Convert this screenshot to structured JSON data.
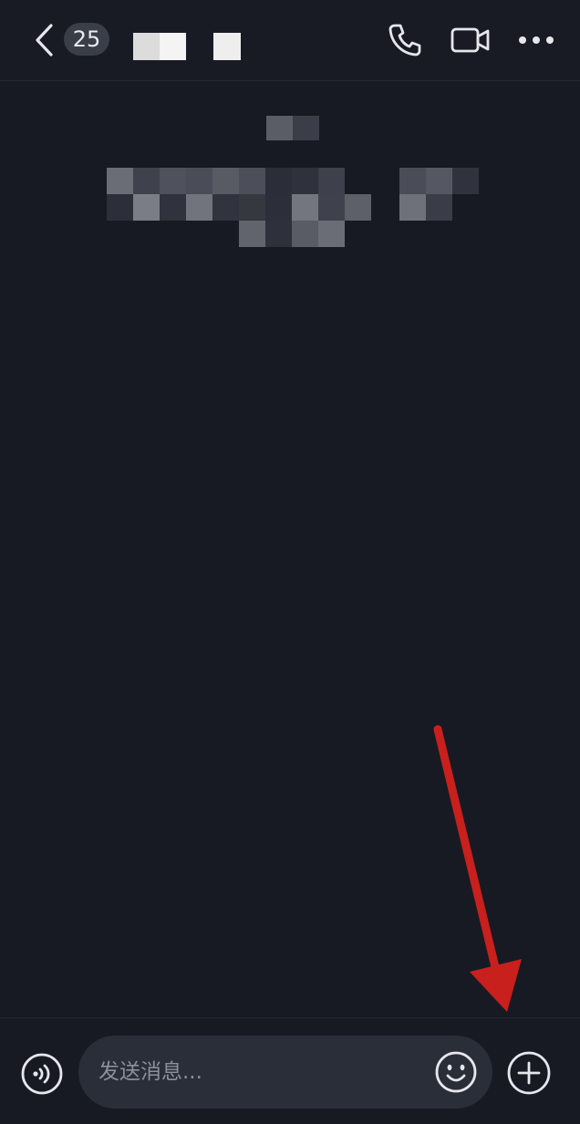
{
  "header": {
    "unread_count": "25",
    "back_icon": "chevron-left-icon",
    "actions": [
      "phone-icon",
      "video-camera-icon",
      "more-horizontal-icon"
    ]
  },
  "composer": {
    "placeholder": "发送消息...",
    "left_icon": "voice-input-icon",
    "emoji_icon": "emoji-face-icon",
    "plus_icon": "plus-circle-icon"
  },
  "colors": {
    "background": "#171a23",
    "input_background": "#2a2e38",
    "annotation_arrow": "#c8201c"
  }
}
